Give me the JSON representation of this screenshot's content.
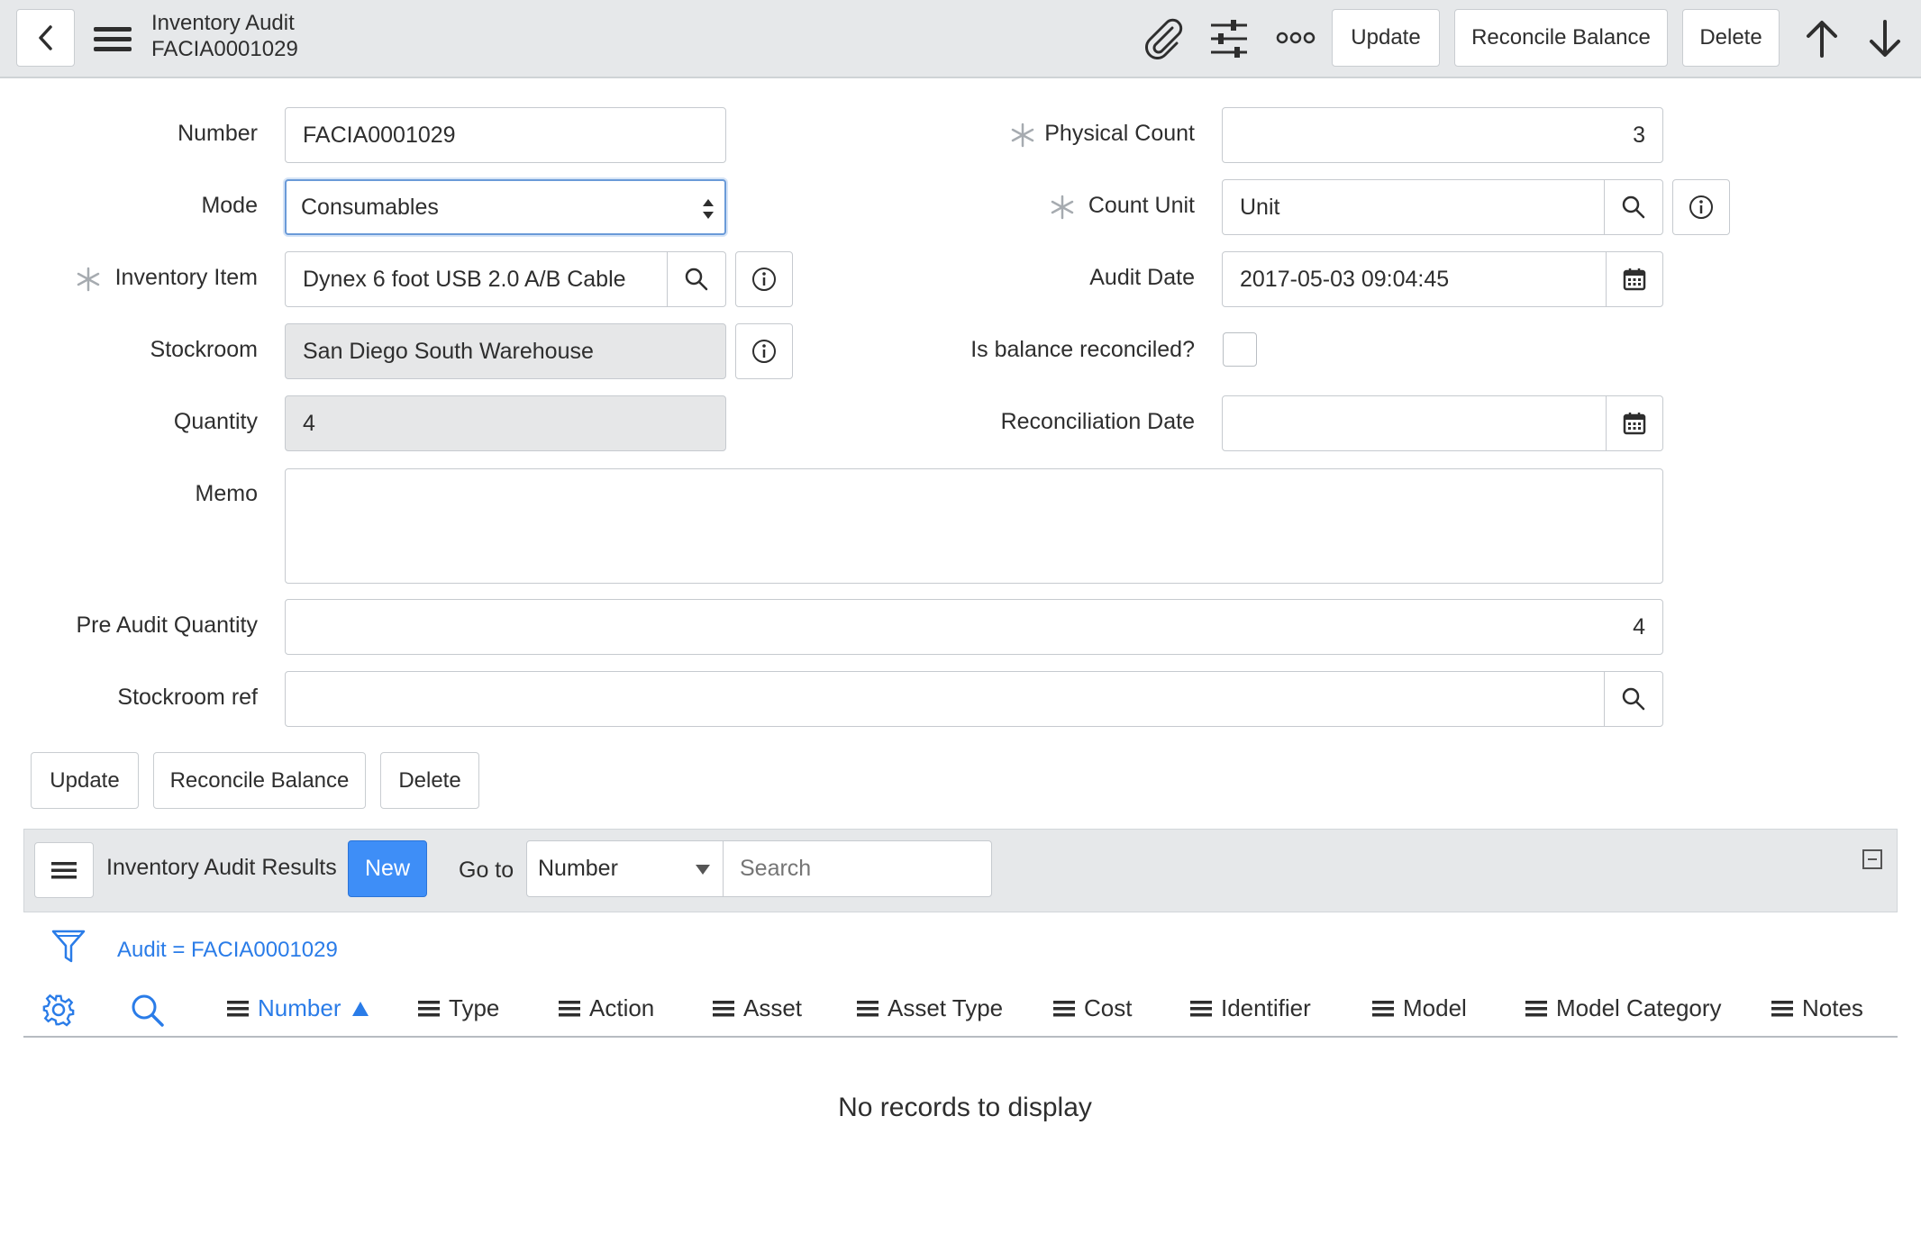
{
  "header": {
    "title": "Inventory Audit",
    "record_number": "FACIA0001029",
    "update_label": "Update",
    "reconcile_label": "Reconcile Balance",
    "delete_label": "Delete"
  },
  "form": {
    "number_label": "Number",
    "number_value": "FACIA0001029",
    "mode_label": "Mode",
    "mode_value": "Consumables",
    "inventory_item_label": "Inventory Item",
    "inventory_item_value": "Dynex 6 foot USB 2.0 A/B Cable",
    "stockroom_label": "Stockroom",
    "stockroom_value": "San Diego South Warehouse",
    "quantity_label": "Quantity",
    "quantity_value": "4",
    "physical_count_label": "Physical Count",
    "physical_count_value": "3",
    "count_unit_label": "Count Unit",
    "count_unit_value": "Unit",
    "audit_date_label": "Audit Date",
    "audit_date_value": "2017-05-03 09:04:45",
    "balance_reconciled_label": "Is balance reconciled?",
    "reconciliation_date_label": "Reconciliation Date",
    "reconciliation_date_value": "",
    "memo_label": "Memo",
    "memo_value": "",
    "pre_audit_quantity_label": "Pre Audit Quantity",
    "pre_audit_quantity_value": "4",
    "stockroom_ref_label": "Stockroom ref",
    "stockroom_ref_value": ""
  },
  "form_buttons": {
    "update_label": "Update",
    "reconcile_label": "Reconcile Balance",
    "delete_label": "Delete"
  },
  "related_list": {
    "title": "Inventory Audit Results",
    "new_label": "New",
    "goto_label": "Go to",
    "goto_field": "Number",
    "search_placeholder": "Search",
    "filter_text": "Audit = FACIA0001029",
    "columns": [
      "Number",
      "Type",
      "Action",
      "Asset",
      "Asset Type",
      "Cost",
      "Identifier",
      "Model",
      "Model Category",
      "Notes"
    ],
    "empty_message": "No records to display"
  },
  "colors": {
    "accent": "#2a7ce8",
    "header_bg": "#e6e8ea",
    "new_button": "#3e8ef7"
  }
}
